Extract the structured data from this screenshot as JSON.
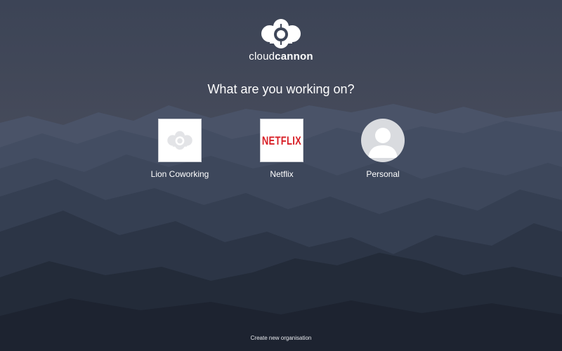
{
  "brand": {
    "name_light": "cloud",
    "name_bold": "cannon"
  },
  "heading": "What are you working on?",
  "organisations": [
    {
      "label": "Lion Coworking",
      "icon": "cloudcannon-logo-icon"
    },
    {
      "label": "Netflix",
      "icon": "netflix-logo-icon",
      "logo_text": "NETFLIX"
    },
    {
      "label": "Personal",
      "icon": "user-avatar-icon"
    }
  ],
  "footer": {
    "create_label": "Create new organisation"
  },
  "colors": {
    "accent_netflix": "#d81f26",
    "background": "#3a4150"
  }
}
